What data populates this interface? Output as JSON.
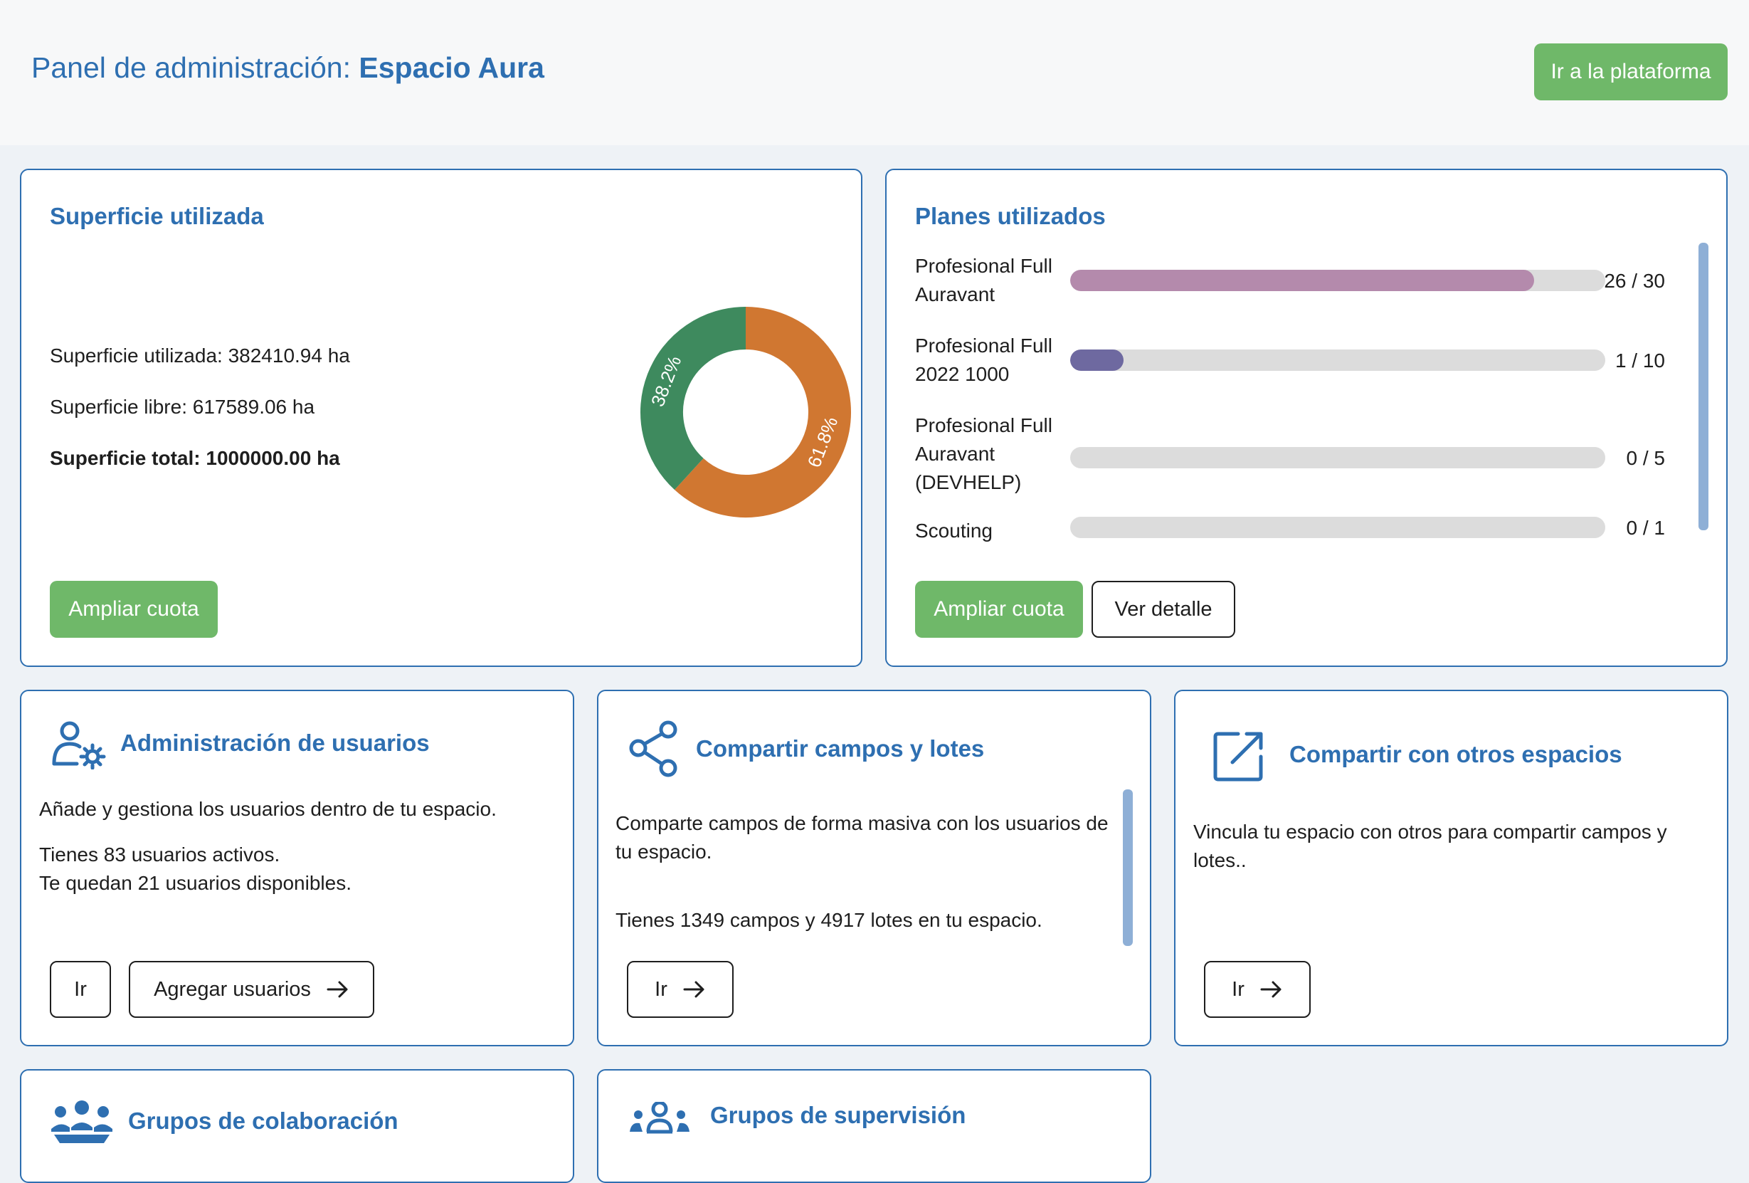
{
  "header": {
    "title_prefix": "Panel de administración:",
    "space_name": "Espacio Aura",
    "platform_button": "Ir a la plataforma"
  },
  "surface_card": {
    "title": "Superficie utilizada",
    "used": "Superficie utilizada: 382410.94 ha",
    "free": "Superficie libre: 617589.06 ha",
    "total": "Superficie total: 1000000.00 ha",
    "expand_button": "Ampliar cuota",
    "chart_data": {
      "type": "pie",
      "categories": [
        "Superficie utilizada",
        "Superficie libre"
      ],
      "values": [
        38.2,
        61.8
      ],
      "labels": [
        "38.2%",
        "61.8%"
      ],
      "colors": [
        "#3e8a5e",
        "#d07731"
      ]
    }
  },
  "plans_card": {
    "title": "Planes utilizados",
    "plans": [
      {
        "name": "Profesional Full Auravant",
        "used": 26,
        "total": 30,
        "count": "26 / 30",
        "color": "#b48aac"
      },
      {
        "name": "Profesional Full 2022 1000",
        "used": 1,
        "total": 10,
        "count": "1 / 10",
        "color": "#6e69a0"
      },
      {
        "name": "Profesional Full Auravant (DEVHELP)",
        "used": 0,
        "total": 5,
        "count": "0 / 5",
        "color": "#6e69a0"
      },
      {
        "name": "Scouting",
        "used": 0,
        "total": 1,
        "count": "0 / 1",
        "color": "#6e69a0"
      }
    ],
    "expand_button": "Ampliar cuota",
    "detail_button": "Ver detalle"
  },
  "users_card": {
    "title": "Administración de usuarios",
    "description": "Añade y gestiona los usuarios dentro de tu espacio.",
    "active": "Tienes 83 usuarios activos.",
    "available": "Te quedan 21 usuarios disponibles.",
    "go_button": "Ir",
    "add_button": "Agregar usuarios"
  },
  "share_fields_card": {
    "title": "Compartir campos y lotes",
    "description": "Comparte campos de forma masiva con los usuarios de tu espacio.",
    "stats": "Tienes 1349 campos y 4917 lotes en tu espacio.",
    "go_button": "Ir"
  },
  "share_spaces_card": {
    "title": "Compartir con otros espacios",
    "description": "Vincula tu espacio con otros para compartir campos y lotes..",
    "go_button": "Ir"
  },
  "collab_card": {
    "title": "Grupos de colaboración"
  },
  "supervision_card": {
    "title": "Grupos de supervisión"
  }
}
